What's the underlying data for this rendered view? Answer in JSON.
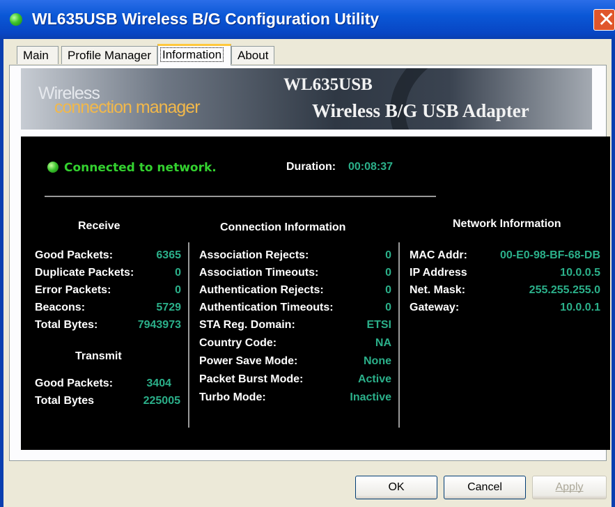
{
  "window": {
    "title": "WL635USB Wireless B/G Configuration Utility",
    "close_icon": "close-x-icon",
    "accent_color": "#0a57d6"
  },
  "tabs": [
    {
      "label": "Main"
    },
    {
      "label": "Profile Manager"
    },
    {
      "label": "Information",
      "active": true
    },
    {
      "label": "About"
    }
  ],
  "banner": {
    "brand_line1": "Wireless",
    "brand_line2": "connection manager",
    "model": "WL635USB",
    "product": "Wireless B/G USB Adapter"
  },
  "status": {
    "text": "Connected to network.",
    "duration_label": "Duration:",
    "duration_value": "00:08:37",
    "color": "#33d12f"
  },
  "receive": {
    "title": "Receive",
    "rows": [
      {
        "label": "Good Packets:",
        "value": "6365"
      },
      {
        "label": "Duplicate Packets:",
        "value": "0"
      },
      {
        "label": "Error Packets:",
        "value": "0"
      },
      {
        "label": "Beacons:",
        "value": "5729"
      },
      {
        "label": "Total Bytes:",
        "value": "7943973"
      }
    ]
  },
  "transmit": {
    "title": "Transmit",
    "rows": [
      {
        "label": "Good Packets:",
        "value": "3404"
      },
      {
        "label": "Total Bytes",
        "value": "225005"
      }
    ]
  },
  "connection": {
    "title": "Connection Information",
    "rows": [
      {
        "label": "Association Rejects:",
        "value": "0"
      },
      {
        "label": "Association Timeouts:",
        "value": "0"
      },
      {
        "label": "Authentication Rejects:",
        "value": "0"
      },
      {
        "label": "Authentication Timeouts:",
        "value": "0"
      },
      {
        "label": "STA Reg. Domain:",
        "value": "ETSI"
      },
      {
        "label": "Country Code:",
        "value": "NA"
      },
      {
        "label": "Power Save Mode:",
        "value": "None"
      },
      {
        "label": "Packet Burst Mode:",
        "value": "Active"
      },
      {
        "label": "Turbo Mode:",
        "value": "Inactive"
      }
    ]
  },
  "network": {
    "title": "Network Information",
    "rows": [
      {
        "label": "MAC Addr:",
        "value": "00-E0-98-BF-68-DB"
      },
      {
        "label": "IP Address",
        "value": "10.0.0.5"
      },
      {
        "label": "Net. Mask:",
        "value": "255.255.255.0"
      },
      {
        "label": "Gateway:",
        "value": "10.0.0.1"
      }
    ]
  },
  "value_color": "#2bb08a",
  "buttons": {
    "ok": "OK",
    "cancel": "Cancel",
    "apply": "Apply"
  }
}
